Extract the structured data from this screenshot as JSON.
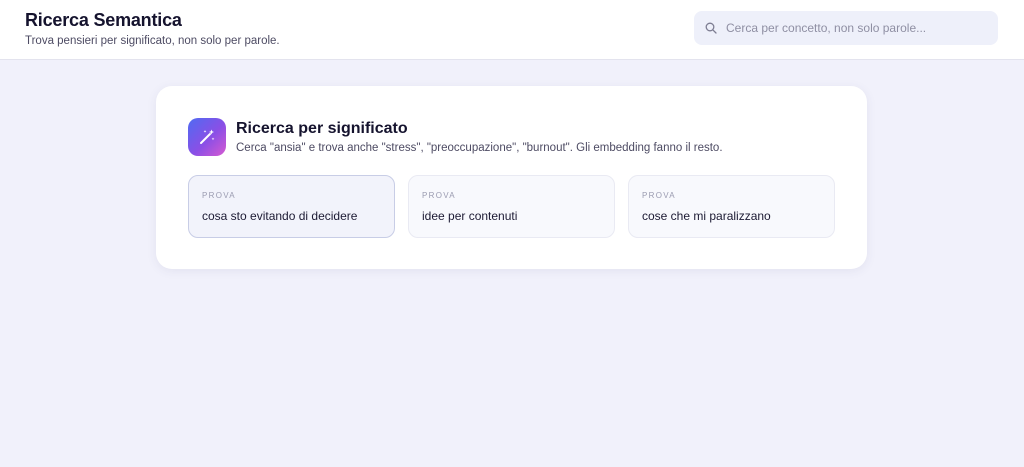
{
  "header": {
    "title": "Ricerca Semantica",
    "subtitle": "Trova pensieri per significato, non solo per parole."
  },
  "search": {
    "placeholder": "Cerca per concetto, non solo parole...",
    "value": "",
    "icon": "search-icon"
  },
  "intro_card": {
    "icon": "magic-wand-icon",
    "title": "Ricerca per significato",
    "description": "Cerca \"ansia\" e trova anche \"stress\", \"preoccupazione\", \"burnout\". Gli embedding fanno il resto.",
    "suggestions": [
      {
        "tag": "PROVA",
        "text": "cosa sto evitando di decidere"
      },
      {
        "tag": "PROVA",
        "text": "idee per contenuti"
      },
      {
        "tag": "PROVA",
        "text": "cose che mi paralizzano"
      }
    ]
  },
  "colors": {
    "background": "#f1f1fb",
    "accent_gradient_start": "#4f6bf2",
    "accent_gradient_end": "#d65ad1"
  }
}
